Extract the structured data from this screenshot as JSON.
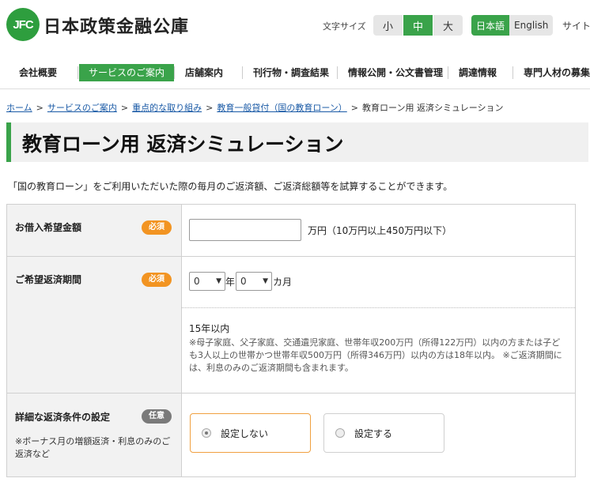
{
  "header": {
    "logo_mark": "JFC",
    "logo_text": "日本政策金融公庫",
    "font_size_label": "文字サイズ",
    "font_sizes": [
      "小",
      "中",
      "大"
    ],
    "font_size_selected": "中",
    "languages": [
      "日本語",
      "English"
    ],
    "language_selected": "日本語",
    "site_link": "サイト"
  },
  "nav": {
    "items": [
      "会社概要",
      "サービスのご案内",
      "店舗案内",
      "刊行物・調査結果",
      "情報公開・公文書管理",
      "調達情報",
      "専門人材の募集"
    ],
    "active": "サービスのご案内"
  },
  "breadcrumb": {
    "items": [
      "ホーム",
      "サービスのご案内",
      "重点的な取り組み",
      "教育一般貸付（国の教育ローン）"
    ],
    "current": "教育ローン用 返済シミュレーション",
    "separator": ">"
  },
  "page": {
    "title": "教育ローン用 返済シミュレーション",
    "intro": "「国の教育ローン」をご利用いただいた際の毎月のご返済額、ご返済総額等を試算することができます。"
  },
  "form": {
    "amount": {
      "label": "お借入希望金額",
      "badge": "必須",
      "value": "",
      "unit_text": "万円（10万円以上450万円以下）"
    },
    "period": {
      "label": "ご希望返済期間",
      "badge": "必須",
      "years_value": "0",
      "years_unit": "年",
      "months_value": "0",
      "months_unit": "カ月",
      "note_head": "15年以内",
      "note_body": "※母子家庭、父子家庭、交通遺児家庭、世帯年収200万円（所得122万円）以内の方または子ども3人以上の世帯かつ世帯年収500万円（所得346万円）以内の方は18年以内。 ※ご返済期間には、利息のみのご返済期間も含まれます。"
    },
    "detail": {
      "label": "詳細な返済条件の設定",
      "badge": "任意",
      "note": "※ボーナス月の増額返済・利息のみのご返済など",
      "options": [
        "設定しない",
        "設定する"
      ],
      "selected": "設定しない"
    }
  },
  "colors": {
    "brand_green": "#3aa34a",
    "required_orange": "#f29422",
    "optional_gray": "#7a7a7a",
    "link_blue": "#1a5aa6"
  }
}
